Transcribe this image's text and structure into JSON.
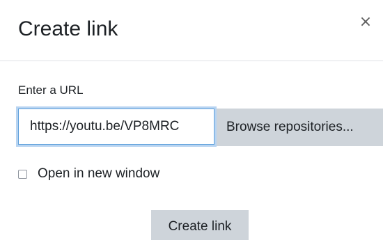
{
  "dialog": {
    "title": "Create link",
    "close_icon": "close-icon",
    "close_glyph": "×"
  },
  "form": {
    "url_label": "Enter a URL",
    "url_value": "https://youtu.be/VP8MRC",
    "browse_label": "Browse repositories...",
    "new_window_label": "Open in new window",
    "new_window_checked": false,
    "submit_label": "Create link"
  },
  "colors": {
    "focus_ring": "#b8d4f1",
    "focus_border": "#5c9fdb",
    "button_background": "#ced4da",
    "divider": "#dee2e6"
  }
}
